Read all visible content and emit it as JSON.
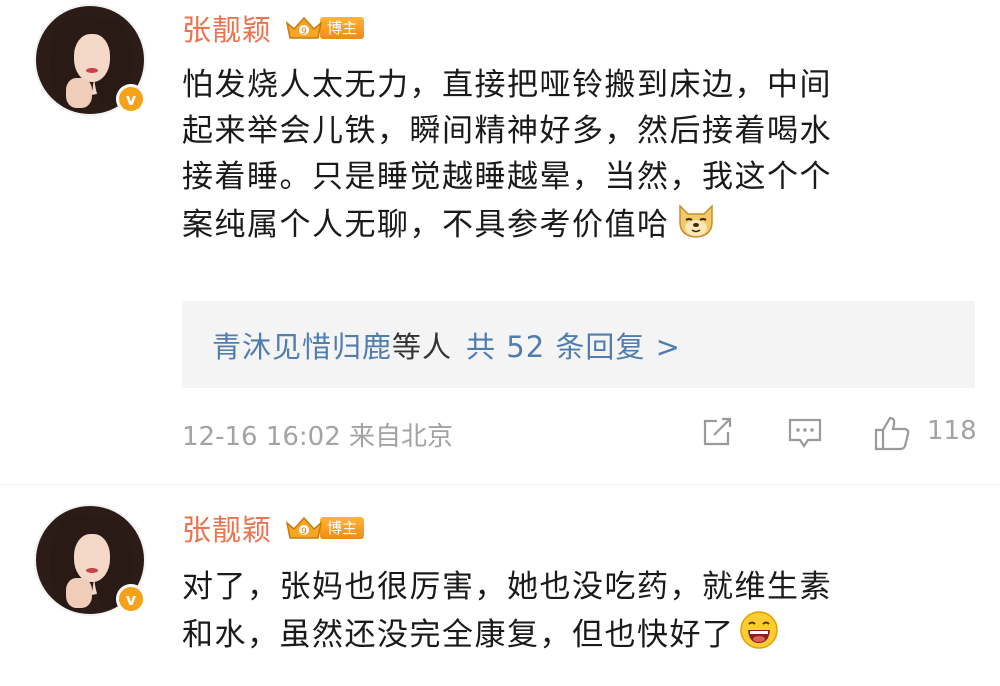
{
  "comments": [
    {
      "username": "张靓颖",
      "badge_label": "博主",
      "verified_mark": "v",
      "text_lines": [
        "怕发烧人太无力，直接把哑铃搬到床边，中间",
        "起来举会儿铁，瞬间精神好多，然后接着喝水",
        "接着睡。只是睡觉越睡越晕，当然，我这个个",
        "案纯属个人无聊，不具参考价值哈"
      ],
      "emoji": "doge-emoji",
      "replies": {
        "names": "青沐见惜归鹿",
        "middle": "等人",
        "count_label": "共 52 条回复 >"
      },
      "time": "12-16 16:02  来自北京",
      "likes": "118"
    },
    {
      "username": "张靓颖",
      "badge_label": "博主",
      "verified_mark": "v",
      "text_lines": [
        "对了，张妈也很厉害，她也没吃药，就维生素",
        "和水，虽然还没完全康复，但也快好了"
      ],
      "emoji": "laughing-emoji"
    }
  ],
  "colors": {
    "username": "#eb7350",
    "link": "#507daf",
    "meta": "#a3a3a3",
    "reply_bg": "#f4f4f4"
  }
}
